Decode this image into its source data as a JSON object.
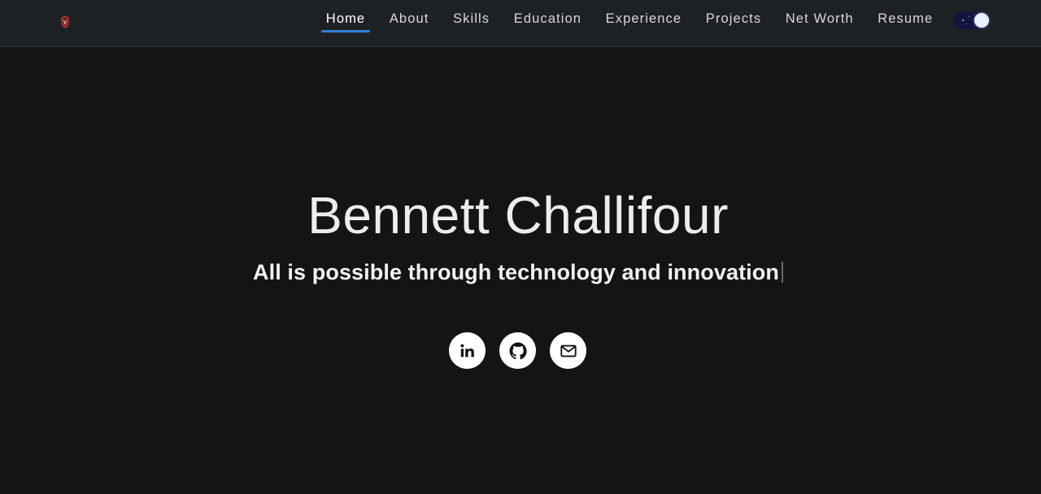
{
  "nav": {
    "items": [
      {
        "label": "Home",
        "active": true
      },
      {
        "label": "About",
        "active": false
      },
      {
        "label": "Skills",
        "active": false
      },
      {
        "label": "Education",
        "active": false
      },
      {
        "label": "Experience",
        "active": false
      },
      {
        "label": "Projects",
        "active": false
      },
      {
        "label": "Net Worth",
        "active": false
      },
      {
        "label": "Resume",
        "active": false
      }
    ],
    "logo_icon": "shield-logo-icon",
    "theme_toggle": {
      "state": "dark",
      "icon": "moon-stars-icon"
    },
    "active_underline_color": "#2f7fd6"
  },
  "hero": {
    "name": "Bennett Challifour",
    "tagline": "All is possible through technology and innovation"
  },
  "socials": [
    {
      "icon": "linkedin-icon"
    },
    {
      "icon": "github-icon"
    },
    {
      "icon": "mail-icon"
    }
  ],
  "colors": {
    "background": "#141414",
    "navbar": "#1e2124",
    "text": "#ededed"
  }
}
